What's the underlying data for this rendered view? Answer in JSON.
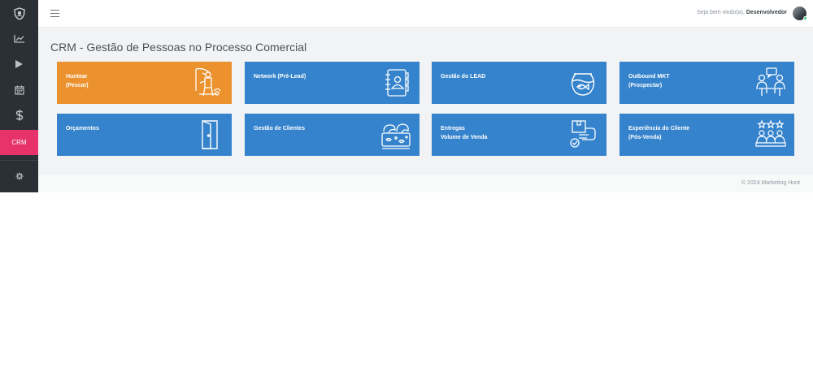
{
  "header": {
    "welcome_prefix": "Seja bem vindo(a),",
    "user_name": "Desenvolvedor"
  },
  "sidebar": {
    "items": [
      {
        "icon": "shield-logo-icon"
      },
      {
        "icon": "line-chart-icon"
      },
      {
        "icon": "play-icon"
      },
      {
        "icon": "calendar-icon"
      },
      {
        "icon": "dollar-icon"
      },
      {
        "label": "CRM",
        "active": true
      },
      {
        "icon": "gear-icon"
      }
    ]
  },
  "page": {
    "title": "CRM - Gestão de Pessoas no Processo Comercial"
  },
  "cards": [
    {
      "line1": "Huntear",
      "line2": "(Pescar)",
      "icon": "fisherman-icon",
      "color": "#eb922f"
    },
    {
      "line1": "Network (Pré-Lead)",
      "line2": "",
      "icon": "contact-book-icon",
      "color": "#3583cc"
    },
    {
      "line1": "Gestão do LEAD",
      "line2": "",
      "icon": "fishbowl-icon",
      "color": "#3583cc"
    },
    {
      "line1": "Outbound MKT",
      "line2": "(Prospectar)",
      "icon": "meeting-people-icon",
      "color": "#3583cc"
    },
    {
      "line1": "Orçamentos",
      "line2": "",
      "icon": "open-door-icon",
      "color": "#3583cc"
    },
    {
      "line1": "Gestão de Clientes",
      "line2": "",
      "icon": "aquarium-icon",
      "color": "#3583cc"
    },
    {
      "line1": "Entregas",
      "line2": "Volume de Venda",
      "icon": "delivery-box-icon",
      "color": "#3583cc"
    },
    {
      "line1": "Experiência do Cliente",
      "line2": "(Pós-Venda)",
      "icon": "customer-rating-icon",
      "color": "#3583cc"
    }
  ],
  "footer": {
    "text": "© 2024 Marketing Hunt"
  }
}
